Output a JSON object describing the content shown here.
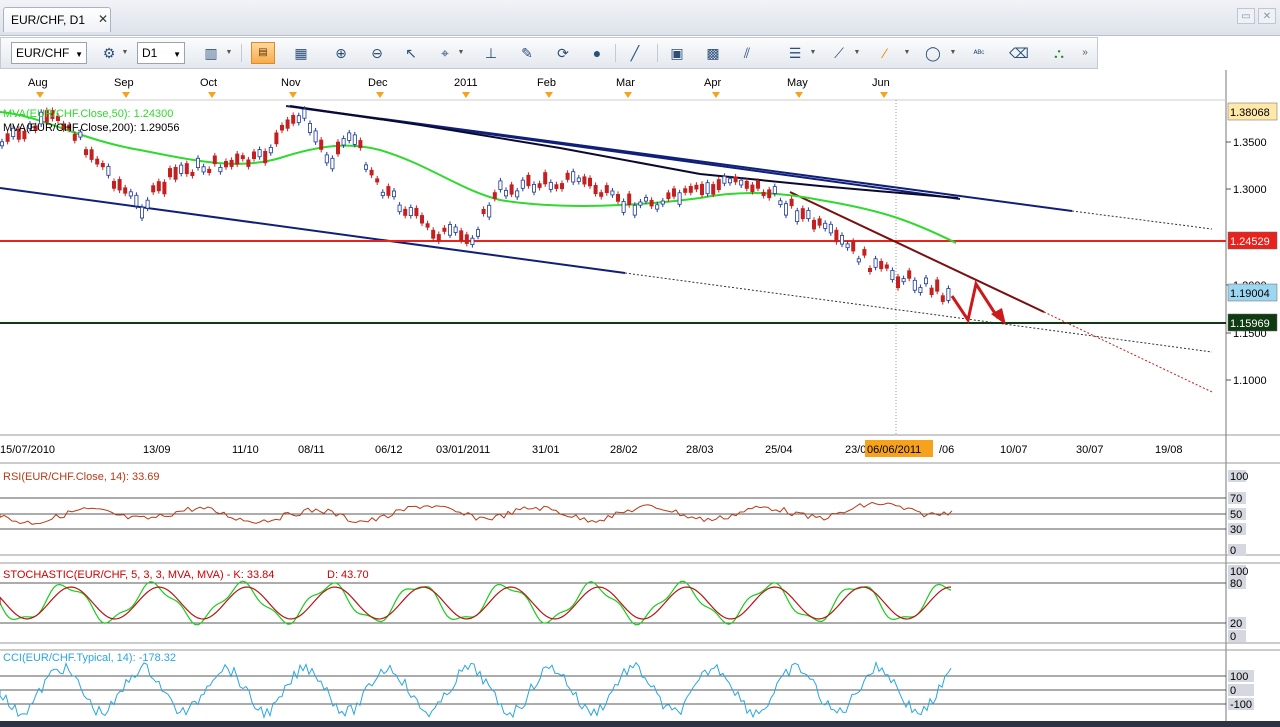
{
  "tab": {
    "title": "EUR/CHF, D1",
    "close": "✕"
  },
  "window_buttons": [
    "▭",
    "✕"
  ],
  "toolbar": {
    "symbol": "EUR/CHF",
    "timeframe": "D1",
    "icons": [
      "indicators-icon",
      "bar-chart-icon",
      "line-chart-icon",
      "zoom-in-icon",
      "zoom-out-icon",
      "cursor-icon",
      "crosshair-icon",
      "period-separator-icon",
      "properties-icon",
      "refresh-icon",
      "globe-icon",
      "ruler-icon",
      "screenshot-icon",
      "template-icon",
      "lines-icon",
      "fibonacci-icon",
      "trendline-icon",
      "pen-icon",
      "ellipse-icon",
      "text-icon",
      "eraser-icon",
      "tree-icon"
    ],
    "more": "»"
  },
  "main": {
    "months": [
      "Aug",
      "Sep",
      "Oct",
      "Nov",
      "Dec",
      "2011",
      "Feb",
      "Mar",
      "Apr",
      "May",
      "Jun"
    ],
    "dates": [
      "15/07/2010",
      "13/09",
      "11/10",
      "08/11",
      "06/12",
      "03/01/2011",
      "31/01",
      "28/02",
      "28/03",
      "25/04",
      "23/05",
      "06/06/2011",
      "/06",
      "10/07",
      "30/07",
      "19/08"
    ],
    "price_ticks": [
      "1.3500",
      "1.3000",
      "1.2000",
      "1.1500",
      "1.1000"
    ],
    "price_flags": [
      {
        "label": "1.38068",
        "color": "#ffe8a8",
        "text": "#000000"
      },
      {
        "label": "1.24529",
        "color": "#e8221c",
        "text": "#ffffff"
      },
      {
        "label": "1.19004",
        "color": "#9dd6f0",
        "text": "#000000"
      },
      {
        "label": "1.15969",
        "color": "#0f3a12",
        "text": "#ffffff"
      }
    ],
    "ma50_legend": "MVA(EUR/CHF.Close,50): 1.24300",
    "ma200_legend": "MVA(EUR/CHF.Close,200): 1.29056",
    "cursor_date": "06/06/2011"
  },
  "rsi": {
    "legend": "RSI(EUR/CHF.Close, 14): 33.69",
    "ticks": [
      "100",
      "70",
      "50",
      "30",
      "0"
    ]
  },
  "stoch": {
    "legend": "STOCHASTIC(EUR/CHF, 5, 3, 3, MVA, MVA) -   K: 33.84",
    "legend_d": "D: 43.70",
    "ticks": [
      "100",
      "80",
      "20",
      "0"
    ]
  },
  "cci": {
    "legend": "CCI(EUR/CHF.Typical, 14): -178.32",
    "ticks": [
      "100",
      "0",
      "-100"
    ]
  },
  "colors": {
    "ma50": "#2fd92f",
    "ma200": "#000000",
    "channel": "#10207a",
    "support": "#e8221c",
    "low": "#0f3a12",
    "trend": "#7a0f0f",
    "arrow": "#cc1a1a",
    "rsi": "#b83a14",
    "stoch_k": "#1bcc1b",
    "stoch_d": "#b81414",
    "cci": "#2aa6e0",
    "bull": "#1f3a9a",
    "bear": "#c42020"
  }
}
